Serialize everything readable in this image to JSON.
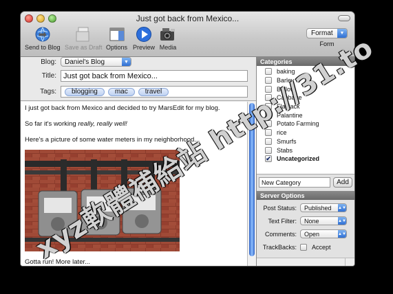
{
  "window": {
    "title": "Just got back from Mexico..."
  },
  "toolbar": {
    "send": "Send to Blog",
    "draft": "Save as Draft",
    "options": "Options",
    "preview": "Preview",
    "media": "Media",
    "format_value": "Format",
    "format_label": "Form"
  },
  "meta": {
    "blog_label": "Blog:",
    "blog_value": "Daniel's Blog",
    "title_label": "Title:",
    "title_value": "Just got back from Mexico...",
    "tags_label": "Tags:",
    "tags": [
      "blogging",
      "mac",
      "travel"
    ]
  },
  "editor": {
    "p1": "I just got back from Mexico and decided to try MarsEdit for my blog.",
    "p2_prefix": "So far it's working ",
    "p2_em": "really, really well!",
    "p3": "Here's a picture of some water meters in my neighborhood...",
    "p4": "Gotta run! More later..."
  },
  "categories": {
    "header": "Categories",
    "items": [
      {
        "label": "baking",
        "checked": false
      },
      {
        "label": "Barley",
        "checked": false
      },
      {
        "label": "Bellow",
        "checked": false
      },
      {
        "label": "Cabbage",
        "checked": false
      },
      {
        "label": "Flapjack",
        "checked": false
      },
      {
        "label": "Palantine",
        "checked": false
      },
      {
        "label": "Potato Farming",
        "checked": false
      },
      {
        "label": "rice",
        "checked": false
      },
      {
        "label": "Smurfs",
        "checked": false
      },
      {
        "label": "Stabs",
        "checked": false
      },
      {
        "label": "Uncategorized",
        "checked": true
      }
    ],
    "new_placeholder": "New Category",
    "add": "Add"
  },
  "server": {
    "header": "Server Options",
    "post_status_label": "Post Status:",
    "post_status": "Published",
    "text_filter_label": "Text Filter:",
    "text_filter": "None",
    "comments_label": "Comments:",
    "comments": "Open",
    "trackbacks_label": "TrackBacks:",
    "accept": "Accept"
  },
  "watermark": "xyz軟體補給站 http://31.to"
}
